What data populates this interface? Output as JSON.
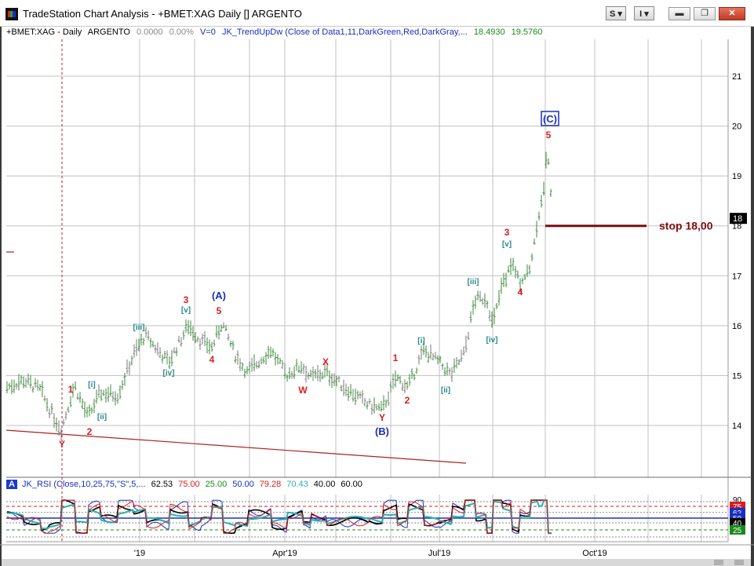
{
  "window": {
    "title": "TradeStation Chart Analysis - +BMET:XAG Daily [] ARGENTO",
    "s_button": "S ▾",
    "i_button": "I ▾",
    "minimize": "▬",
    "maximize": "❐",
    "close": "✕"
  },
  "header": {
    "symbol": "+BMET:XAG - Daily",
    "name": "ARGENTO",
    "change": "0.0000",
    "pct": "0.00%",
    "volume": "V=0",
    "indicator": "JK_TrendUpDw (Close of Data1,11,DarkGreen,Red,DarkGray,...",
    "val1": "18.4930",
    "val2": "19.5760"
  },
  "colors": {
    "background": "#ffffff",
    "grid": "#c0c0c0",
    "bar": "#3d8a3d",
    "wave_red": "#d81e1e",
    "wave_blue": "#1a2fbf",
    "wave_teal": "#2a8a8a",
    "stop_line": "#7a0f0f",
    "trendline": "#b02020"
  },
  "price_axis": {
    "ticks": [
      "21",
      "20",
      "19",
      "18",
      "17",
      "16",
      "15",
      "14"
    ],
    "current_price": "18"
  },
  "time_axis": {
    "labels": [
      "'19",
      "Apr'19",
      "Jul'19",
      "Oct'19"
    ]
  },
  "annotations": {
    "stop_label": "stop 18,00",
    "wave_labels": [
      {
        "text": "Y",
        "color": "red"
      },
      {
        "text": "1",
        "color": "red"
      },
      {
        "text": "2",
        "color": "red"
      },
      {
        "text": "[i]",
        "color": "teal"
      },
      {
        "text": "[ii]",
        "color": "teal"
      },
      {
        "text": "[iii]",
        "color": "teal"
      },
      {
        "text": "[iv]",
        "color": "teal"
      },
      {
        "text": "[v]",
        "color": "teal"
      },
      {
        "text": "3",
        "color": "red"
      },
      {
        "text": "4",
        "color": "red"
      },
      {
        "text": "5",
        "color": "red"
      },
      {
        "text": "(A)",
        "color": "blue"
      },
      {
        "text": "W",
        "color": "red"
      },
      {
        "text": "X",
        "color": "red"
      },
      {
        "text": "Y",
        "color": "red"
      },
      {
        "text": "(B)",
        "color": "blue"
      },
      {
        "text": "1",
        "color": "red"
      },
      {
        "text": "2",
        "color": "red"
      },
      {
        "text": "[i]",
        "color": "teal"
      },
      {
        "text": "[ii]",
        "color": "teal"
      },
      {
        "text": "[iii]",
        "color": "teal"
      },
      {
        "text": "[iv]",
        "color": "teal"
      },
      {
        "text": "[v]",
        "color": "teal"
      },
      {
        "text": "3",
        "color": "red"
      },
      {
        "text": "4",
        "color": "red"
      },
      {
        "text": "5",
        "color": "red"
      },
      {
        "text": "(C)",
        "color": "blue"
      }
    ]
  },
  "indicator": {
    "label": "A",
    "name": "JK_RSI (Close,10,25,75,\"S\",5,...",
    "values": [
      "62.53",
      "75.00",
      "25.00",
      "50.00",
      "79.28",
      "70.43",
      "40.00",
      "60.00"
    ],
    "value_colors": [
      "#000000",
      "#d81e1e",
      "#1a8a1a",
      "#1a2fbf",
      "#d81e1e",
      "#2ab0b0",
      "#000000",
      "#000000"
    ],
    "axis_ticks": [
      "90",
      "75",
      "62",
      "50",
      "40",
      "25"
    ],
    "tick_colors": [
      "#ffffff",
      "#d81e1e",
      "#1a2fbf",
      "#1a2fbf",
      "#000000",
      "#1a8a1a"
    ]
  },
  "chart_data": {
    "type": "ohlc",
    "title": "+BMET:XAG Daily ARGENTO",
    "y_range": [
      13.15,
      21.9
    ],
    "x_labels": [
      "'19",
      "Apr'19",
      "Jul'19",
      "Oct'19"
    ],
    "price_path": [
      {
        "x": 8,
        "y": 14.75
      },
      {
        "x": 30,
        "y": 14.9
      },
      {
        "x": 52,
        "y": 14.7
      },
      {
        "x": 62,
        "y": 14.35
      },
      {
        "x": 78,
        "y": 13.9
      },
      {
        "x": 95,
        "y": 14.8
      },
      {
        "x": 112,
        "y": 14.15
      },
      {
        "x": 128,
        "y": 14.65
      },
      {
        "x": 150,
        "y": 14.6
      },
      {
        "x": 170,
        "y": 15.4
      },
      {
        "x": 185,
        "y": 15.8
      },
      {
        "x": 215,
        "y": 15.25
      },
      {
        "x": 240,
        "y": 16.0
      },
      {
        "x": 255,
        "y": 15.7
      },
      {
        "x": 270,
        "y": 15.55
      },
      {
        "x": 283,
        "y": 16.05
      },
      {
        "x": 300,
        "y": 15.4
      },
      {
        "x": 315,
        "y": 15.05
      },
      {
        "x": 345,
        "y": 15.5
      },
      {
        "x": 365,
        "y": 15.0
      },
      {
        "x": 385,
        "y": 15.2
      },
      {
        "x": 395,
        "y": 14.95
      },
      {
        "x": 415,
        "y": 15.05
      },
      {
        "x": 440,
        "y": 14.75
      },
      {
        "x": 470,
        "y": 14.4
      },
      {
        "x": 487,
        "y": 14.3
      },
      {
        "x": 505,
        "y": 14.95
      },
      {
        "x": 520,
        "y": 14.75
      },
      {
        "x": 540,
        "y": 15.5
      },
      {
        "x": 560,
        "y": 15.25
      },
      {
        "x": 575,
        "y": 15.0
      },
      {
        "x": 592,
        "y": 15.45
      },
      {
        "x": 605,
        "y": 16.5
      },
      {
        "x": 620,
        "y": 16.55
      },
      {
        "x": 628,
        "y": 16.0
      },
      {
        "x": 640,
        "y": 16.8
      },
      {
        "x": 652,
        "y": 17.25
      },
      {
        "x": 662,
        "y": 16.85
      },
      {
        "x": 675,
        "y": 17.1
      },
      {
        "x": 685,
        "y": 18.1
      },
      {
        "x": 692,
        "y": 18.6
      },
      {
        "x": 698,
        "y": 19.55
      },
      {
        "x": 703,
        "y": 18.5
      }
    ],
    "stop": 18.0,
    "rsi_range": [
      0,
      100
    ],
    "rsi_levels": [
      90,
      75,
      62,
      50,
      40,
      25
    ],
    "rsi_current": 62.53
  }
}
